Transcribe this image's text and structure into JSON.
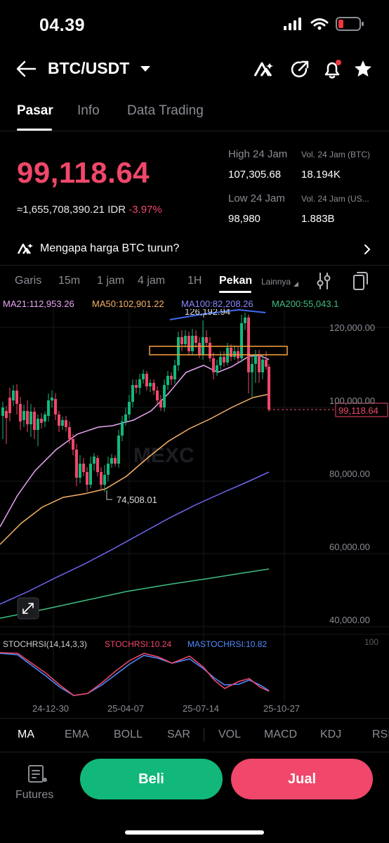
{
  "status_bar": {
    "time": "04.39"
  },
  "header": {
    "pair": "BTC/USDT",
    "icons": [
      "back-arrow-icon",
      "dropdown-caret-icon",
      "ai-logo-icon",
      "share-icon",
      "bell-icon",
      "star-icon"
    ]
  },
  "tabs": [
    {
      "label": "Pasar",
      "active": true
    },
    {
      "label": "Info",
      "active": false
    },
    {
      "label": "Data Trading",
      "active": false
    }
  ],
  "price": {
    "last": "99,118.64",
    "idr": "≈1,655,708,390.21",
    "currency": "IDR",
    "change": "-3.97%",
    "color_down": "#f0476a",
    "color_up": "#12b87a"
  },
  "stats": {
    "high_label": "High 24 Jam",
    "high_value": "107,305.68",
    "vol_btc_label": "Vol. 24 Jam (BTC)",
    "vol_btc_value": "18.194K",
    "low_label": "Low 24 Jam",
    "low_value": "98,980",
    "vol_usdt_label": "Vol. 24 Jam (US...",
    "vol_usdt_value": "1.883B"
  },
  "why_banner": {
    "text": "Mengapa harga BTC turun?"
  },
  "timeframes": [
    {
      "label": "Garis",
      "active": false
    },
    {
      "label": "15m",
      "active": false
    },
    {
      "label": "1 jam",
      "active": false
    },
    {
      "label": "4 jam",
      "active": false
    },
    {
      "label": "1H",
      "active": false
    },
    {
      "label": "Pekan",
      "active": true
    },
    {
      "label": "Lainnya",
      "active": false
    }
  ],
  "ma_legend": {
    "ma21": "MA21:112,953.26",
    "ma50": "MA50:102,901.22",
    "ma100": "MA100:82,208.26",
    "ma200": "MA200:55,043.1"
  },
  "chart_data": {
    "type": "candlestick",
    "y_ticks": [
      "120,000.00",
      "100,000.00",
      "80,000.00",
      "60,000.00",
      "40,000.00"
    ],
    "x_ticks": [
      "24-12-30",
      "25-04-07",
      "25-07-14",
      "25-10-27"
    ],
    "last_price_label": "99,118.64",
    "high_annotation": "126,192.94",
    "low_annotation": "74,508.01",
    "watermark": "MEXC",
    "ma_colors": {
      "ma21": "#e9a6f5",
      "ma50": "#f7b267",
      "ma100": "#6f6af8",
      "ma200": "#3fbf7f"
    },
    "stoch_legend": {
      "name": "STOCHRSI(14,14,3,3)",
      "stoch": "STOCHRSI:10.24",
      "ma": "MASTOCHRSI:10.82",
      "scale_top": "100"
    }
  },
  "indicators": [
    "MA",
    "EMA",
    "BOLL",
    "SAR",
    "VOL",
    "MACD",
    "KDJ",
    "RSI"
  ],
  "footer": {
    "futures_label": "Futures",
    "buy_label": "Beli",
    "sell_label": "Jual"
  }
}
